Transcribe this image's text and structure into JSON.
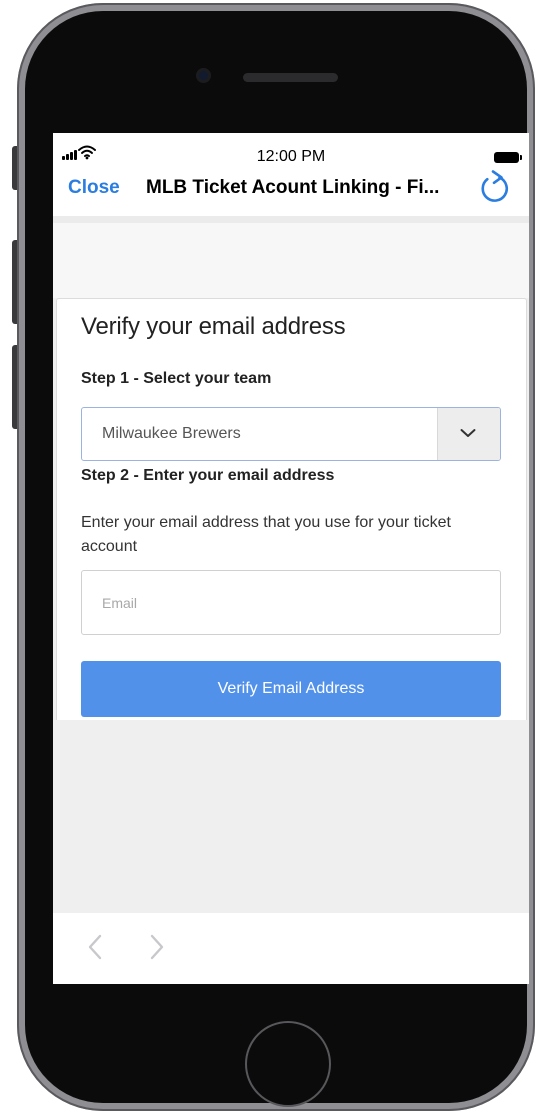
{
  "status_bar": {
    "time": "12:00 PM"
  },
  "nav_bar": {
    "close_label": "Close",
    "title": "MLB Ticket Acount Linking - Fi..."
  },
  "form": {
    "title": "Verify your email address",
    "step1_label": "Step 1 - Select your team",
    "selected_team": "Milwaukee Brewers",
    "step2_label": "Step 2 - Enter your email address",
    "instructions": "Enter your email address that you use for your ticket account",
    "email_value": "",
    "email_placeholder": "Email",
    "submit_label": "Verify Email Address"
  },
  "icons": {
    "signal": "cellular-signal-icon",
    "wifi": "wifi-icon",
    "battery": "battery-icon",
    "refresh": "refresh-icon",
    "dropdown": "chevron-down-icon",
    "back": "chevron-left-icon",
    "forward": "chevron-right-icon"
  },
  "colors": {
    "accent": "#2b7de0",
    "button": "#5191ea",
    "select_border": "#9db3df",
    "page_background": "#efefef"
  }
}
